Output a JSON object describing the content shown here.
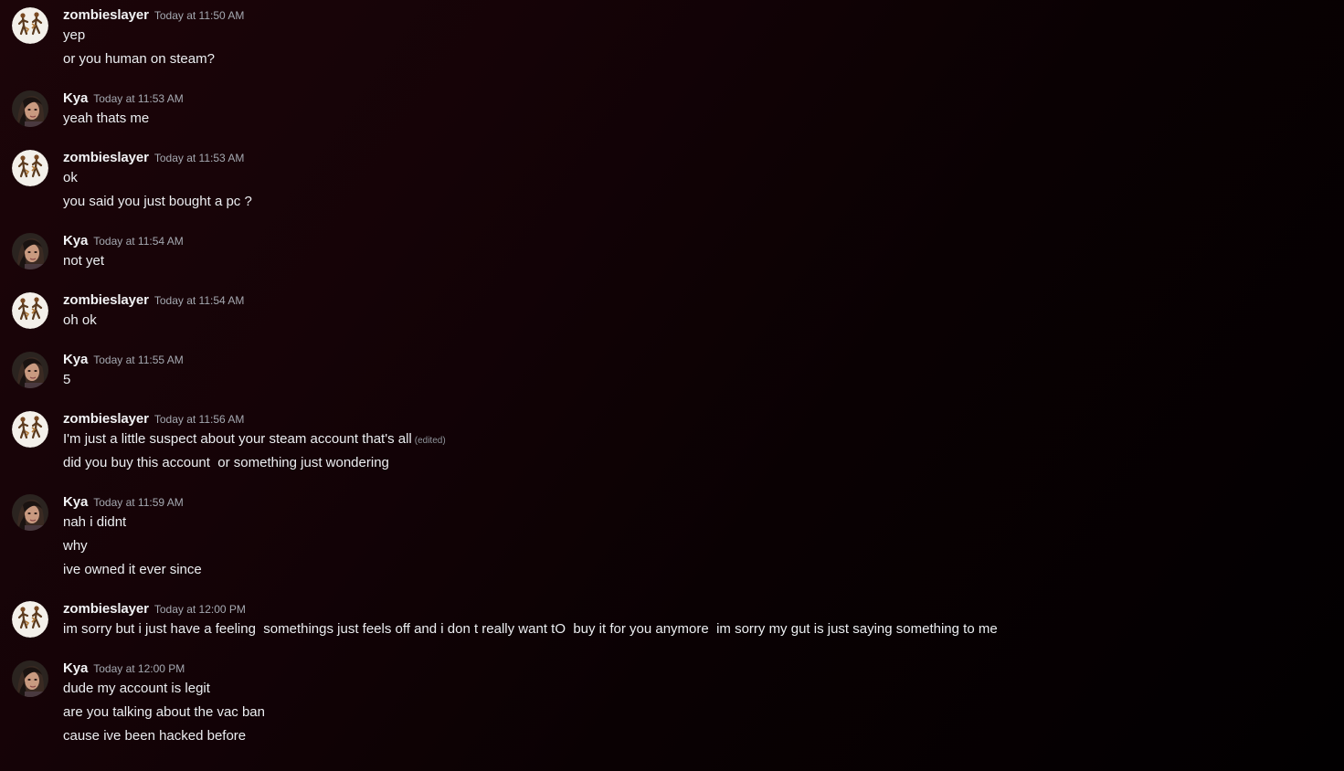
{
  "messages": [
    {
      "author": "zombieslayer",
      "time": "Today at 11:50 AM",
      "lines": [
        "yep",
        "or you human on steam?"
      ]
    },
    {
      "author": "Kya",
      "time": "Today at 11:53 AM",
      "lines": [
        "yeah thats me"
      ]
    },
    {
      "author": "zombieslayer",
      "time": "Today at 11:53 AM",
      "lines": [
        "ok",
        "you said you just bought a pc ?"
      ]
    },
    {
      "author": "Kya",
      "time": "Today at 11:54 AM",
      "lines": [
        "not yet"
      ]
    },
    {
      "author": "zombieslayer",
      "time": "Today at 11:54 AM",
      "lines": [
        "oh ok"
      ]
    },
    {
      "author": "Kya",
      "time": "Today at 11:55 AM",
      "lines": [
        "5"
      ]
    },
    {
      "author": "zombieslayer",
      "time": "Today at 11:56 AM",
      "lines": [
        "I'm just a little suspect about your steam account that's all",
        "did you buy this account  or something just wondering"
      ],
      "edited_label": "(edited)"
    },
    {
      "author": "Kya",
      "time": "Today at 11:59 AM",
      "lines": [
        "nah i didnt",
        "why",
        "ive owned it ever since"
      ]
    },
    {
      "author": "zombieslayer",
      "time": "Today at 12:00 PM",
      "lines": [
        "im sorry but i just have a feeling  somethings just feels off and i don t really want tO  buy it for you anymore  im sorry my gut is just saying something to me"
      ]
    },
    {
      "author": "Kya",
      "time": "Today at 12:00 PM",
      "lines": [
        "dude my account is legit",
        "are you talking about the vac ban",
        "cause ive been hacked before"
      ]
    }
  ],
  "colors": {
    "username": "#f2f3f5",
    "timestamp": "#a5a9b1",
    "message_text": "#eceef1",
    "background_start": "#1c0509",
    "background_end": "#020001"
  },
  "avatars": {
    "zombieslayer": "zombie-figures-avatar-icon",
    "Kya": "girl-portrait-avatar-icon"
  }
}
